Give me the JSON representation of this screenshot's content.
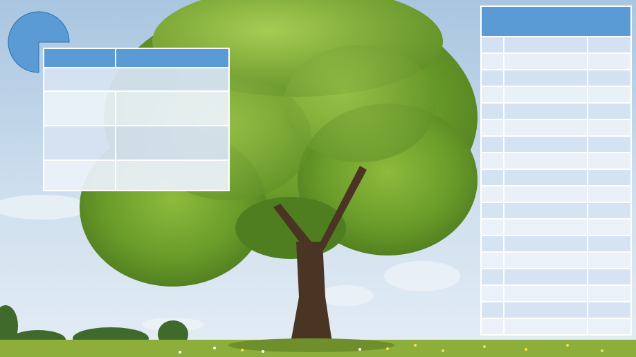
{
  "slide": {
    "background": "photo-of-lone-tree-in-meadow",
    "accent_color": "#5b9bd5",
    "pie_fraction": 0.75
  },
  "table_a": {
    "header": [
      "",
      ""
    ],
    "rows": [
      [
        ""
      ],
      [
        "",
        ""
      ],
      [
        "",
        ""
      ],
      [
        "",
        ""
      ]
    ]
  },
  "table_b": {
    "header": [
      ""
    ],
    "rows": [
      [
        "",
        "",
        ""
      ],
      [
        "",
        "",
        ""
      ],
      [
        "",
        "",
        ""
      ],
      [
        "",
        "",
        ""
      ],
      [
        "",
        "",
        ""
      ],
      [
        "",
        "",
        ""
      ],
      [
        "",
        "",
        ""
      ],
      [
        "",
        "",
        ""
      ],
      [
        "",
        "",
        ""
      ],
      [
        "",
        "",
        ""
      ],
      [
        "",
        "",
        ""
      ],
      [
        "",
        "",
        ""
      ],
      [
        "",
        "",
        ""
      ],
      [
        "",
        "",
        ""
      ],
      [
        "",
        "",
        ""
      ],
      [
        "",
        "",
        ""
      ],
      [
        "",
        "",
        ""
      ],
      [
        "",
        "",
        ""
      ]
    ]
  }
}
